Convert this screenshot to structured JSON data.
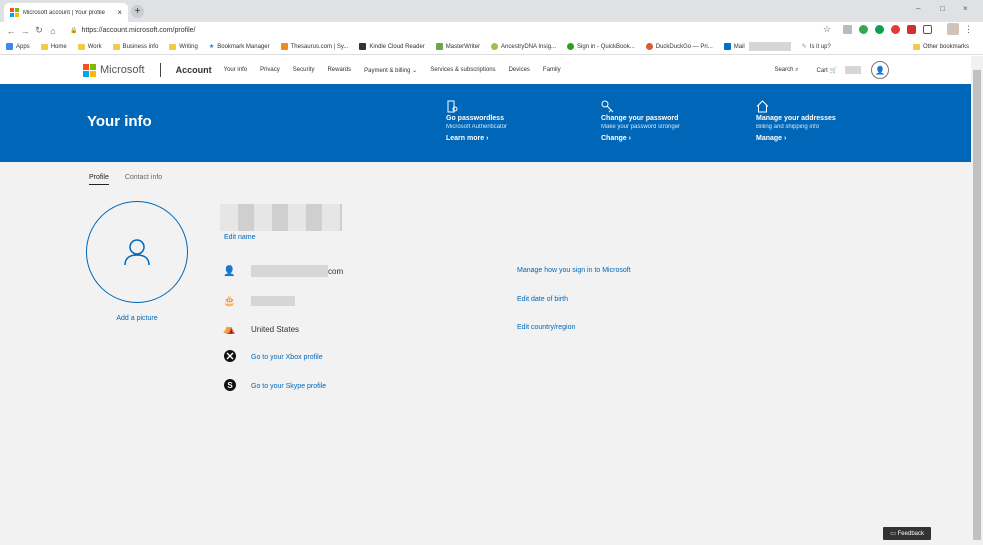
{
  "browser": {
    "tab_title": "Microsoft account | Your profile",
    "tab_close": "×",
    "new_tab": "+",
    "window_controls": [
      "–",
      "□",
      "×"
    ],
    "url_secure": "🔒",
    "url": "https://account.microsoft.com/profile/",
    "bookmarks": [
      "Apps",
      "Home",
      "Work",
      "Business info",
      "Writing",
      "Bookmark Manager",
      "Thesaurus.com | Sy...",
      "Kindle Cloud Reader",
      "MasterWriter",
      "AncestryDNA Insig...",
      "Sign in - QuickBook...",
      "DuckDuckGo — Pri...",
      "Mail",
      "Is it up?"
    ],
    "other_bookmarks": "Other bookmarks"
  },
  "topnav": {
    "brand": "Microsoft",
    "account": "Account",
    "items": [
      "Your info",
      "Privacy",
      "Security",
      "Rewards",
      "Payment & billing ⌄",
      "Services & subscriptions",
      "Devices",
      "Family"
    ],
    "search": "Search",
    "cart": "Cart"
  },
  "banner": {
    "title": "Your info",
    "promos": [
      {
        "icon": "passwordless-icon",
        "title": "Go passwordless",
        "subtitle": "Microsoft Authenticator",
        "link": "Learn more ›"
      },
      {
        "icon": "key-icon",
        "title": "Change your password",
        "subtitle": "Make your password stronger",
        "link": "Change ›"
      },
      {
        "icon": "home-icon",
        "title": "Manage your addresses",
        "subtitle": "Billing and shipping info",
        "link": "Manage ›"
      }
    ]
  },
  "tabs": [
    "Profile",
    "Contact info"
  ],
  "profile": {
    "add_picture": "Add a picture",
    "edit_name": "Edit name",
    "email_suffix": "com",
    "country": "United States",
    "xbox_link": "Go to your Xbox profile",
    "skype_link": "Go to your Skype profile",
    "actions": [
      "Manage how you sign in to Microsoft",
      "Edit date of birth",
      "Edit country/region"
    ]
  },
  "feedback": "Feedback",
  "colors": {
    "brand_blue": "#0067b8",
    "ms_red": "#f25022",
    "ms_green": "#7fba00",
    "ms_blue": "#00a4ef",
    "ms_yellow": "#ffb900"
  }
}
